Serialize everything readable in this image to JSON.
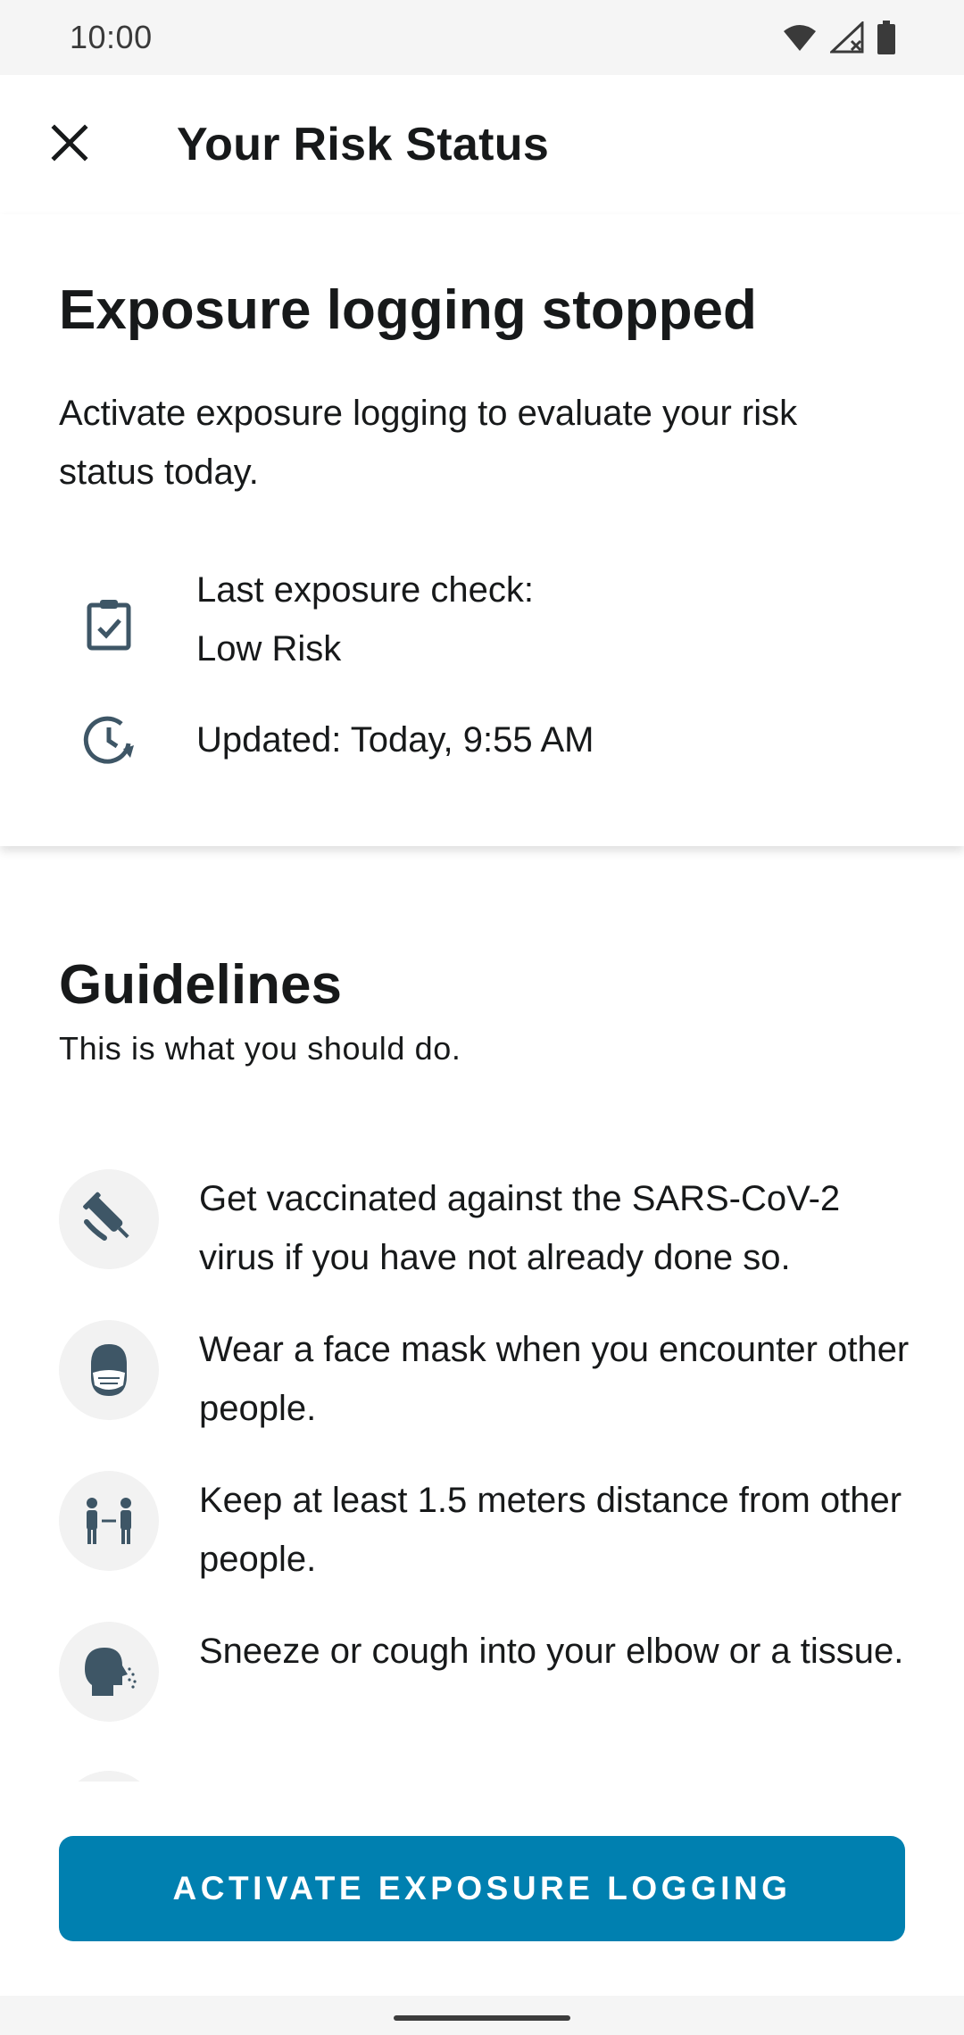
{
  "status_bar": {
    "time": "10:00",
    "icons": [
      "wifi-icon",
      "signal-off-icon",
      "battery-icon"
    ]
  },
  "app_bar": {
    "close_icon": "close-icon",
    "title": "Your Risk Status"
  },
  "risk_card": {
    "headline": "Exposure logging stopped",
    "body": "Activate exposure logging to evaluate your risk status today.",
    "last_check": {
      "icon": "clipboard-check-icon",
      "label": "Last exposure check:",
      "value": "Low Risk"
    },
    "updated": {
      "icon": "clock-refresh-icon",
      "text": "Updated: Today, 9:55 AM"
    }
  },
  "guidelines": {
    "title": "Guidelines",
    "subtitle": "This is what you should do.",
    "items": [
      {
        "icon": "vaccine-icon",
        "text": "Get vaccinated against the SARS-CoV-2 virus if you have not already done so."
      },
      {
        "icon": "face-mask-icon",
        "text": "Wear a face mask when you encounter other people."
      },
      {
        "icon": "distance-icon",
        "text": "Keep at least 1.5 meters distance from other people."
      },
      {
        "icon": "sneeze-icon",
        "text": "Sneeze or cough into your elbow or a tissue."
      }
    ]
  },
  "footer": {
    "button_label": "ACTIVATE EXPOSURE LOGGING"
  },
  "colors": {
    "primary": "#0080b0",
    "icon": "#3e5666",
    "text": "#17191a",
    "icon_bg": "#f2f2f2"
  }
}
